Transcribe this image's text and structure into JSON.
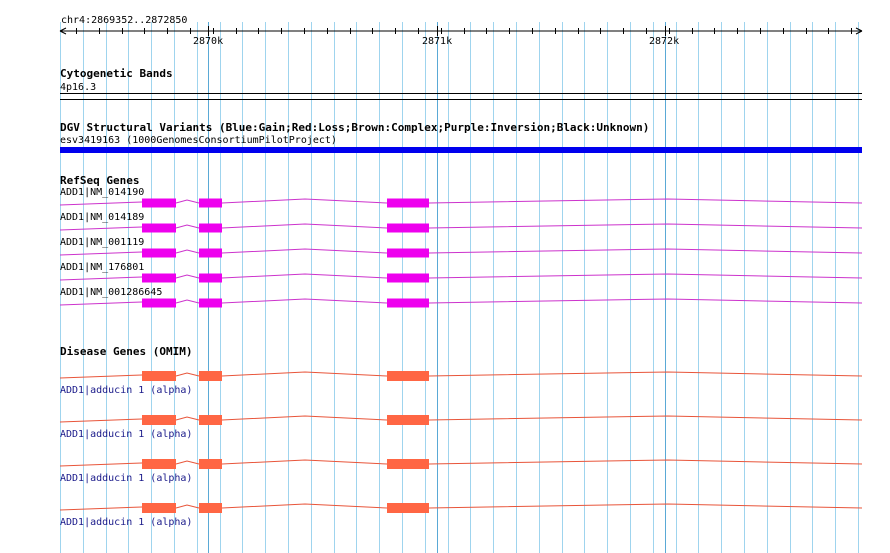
{
  "ruler": {
    "range_label": "chr4:2869352..2872850",
    "ticks": [
      "2870k",
      "2871k",
      "2872k"
    ]
  },
  "tracks": {
    "cytoband": {
      "title": "Cytogenetic Bands",
      "band": "4p16.3"
    },
    "dgv": {
      "title": "DGV Structural Variants (Blue:Gain;Red:Loss;Brown:Complex;Purple:Inversion;Black:Unknown)",
      "feature": "esv3419163 (1000GenomesConsortiumPilotProject)",
      "feature_color": "#0000ee"
    },
    "refseq": {
      "title": "RefSeq Genes",
      "color": "#ee00ee",
      "line_color": "#cc33cc",
      "genes": [
        "ADD1|NM_014190",
        "ADD1|NM_014189",
        "ADD1|NM_001119",
        "ADD1|NM_176801",
        "ADD1|NM_001286645"
      ]
    },
    "omim": {
      "title": "Disease Genes (OMIM)",
      "color": "#ff6644",
      "line_color": "#e8553a",
      "genes": [
        "ADD1|adducin 1 (alpha)",
        "ADD1|adducin 1 (alpha)",
        "ADD1|adducin 1 (alpha)",
        "ADD1|adducin 1 (alpha)"
      ]
    }
  },
  "grid_color": "#9fd4ee",
  "grid_major_color": "#5aa9d6"
}
